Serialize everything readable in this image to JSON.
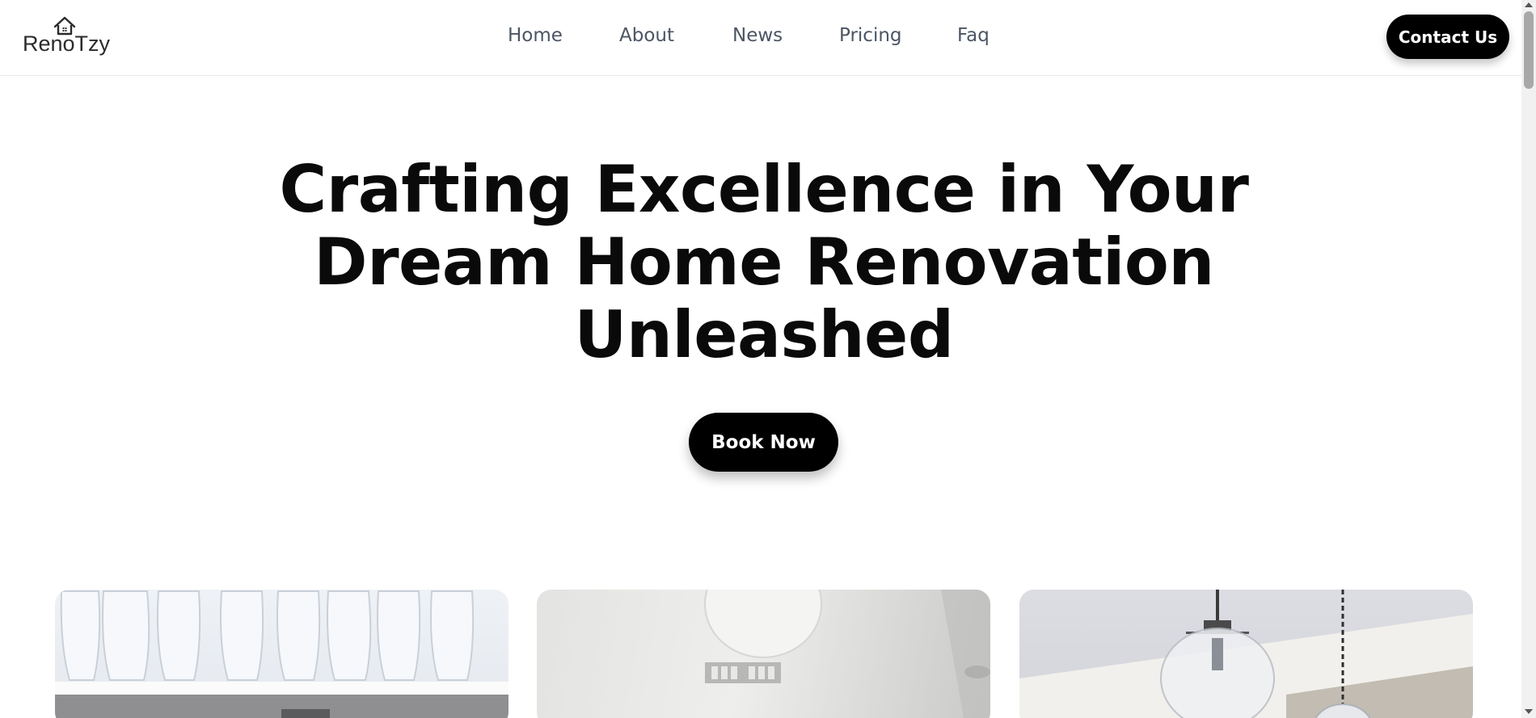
{
  "header": {
    "logo_text": "RenoTzy",
    "logo_icon": "house-icon",
    "nav": [
      {
        "label": "Home"
      },
      {
        "label": "About"
      },
      {
        "label": "News"
      },
      {
        "label": "Pricing"
      },
      {
        "label": "Faq"
      }
    ],
    "contact_label": "Contact Us"
  },
  "hero": {
    "title": "Crafting Excellence in Your Dream Home Renovation Unleashed",
    "cta_label": "Book Now"
  },
  "gallery": [
    {
      "subject": "glass-shelf-photo"
    },
    {
      "subject": "ceiling-lamp-photo"
    },
    {
      "subject": "pendant-lights-photo"
    }
  ],
  "colors": {
    "primary": "#000000",
    "nav_text": "#4b5563",
    "title_text": "#0a0a0a",
    "background": "#ffffff"
  }
}
